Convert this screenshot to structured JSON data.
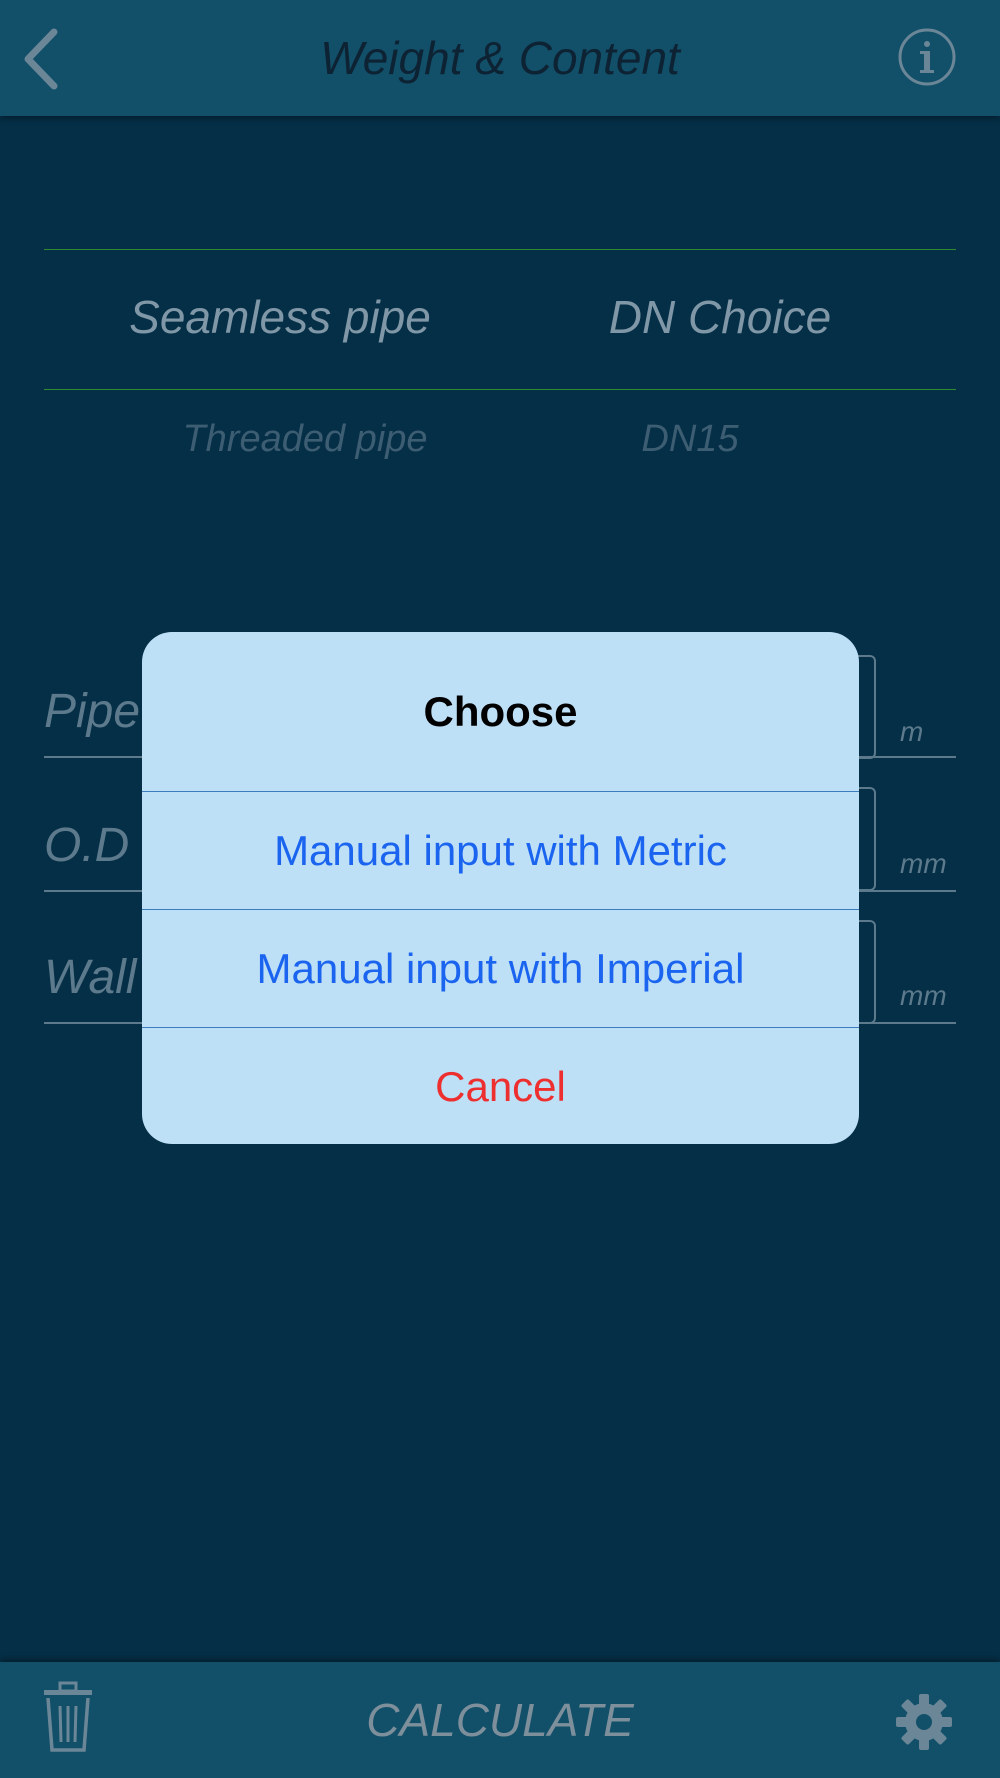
{
  "header": {
    "title": "Weight & Content",
    "back_icon": "chevron-left-icon",
    "info_icon": "info-icon"
  },
  "picker": {
    "selected": {
      "pipe_type": "Seamless pipe",
      "dn": "DN Choice"
    },
    "next": {
      "pipe_type": "Threaded pipe",
      "dn": "DN15"
    }
  },
  "fields": [
    {
      "label": "Pipe",
      "unit": "m"
    },
    {
      "label": "O.D",
      "unit": "mm"
    },
    {
      "label": "Wall",
      "unit": "mm"
    }
  ],
  "dialog": {
    "title": "Choose",
    "options": [
      "Manual input with Metric",
      "Manual input with Imperial"
    ],
    "cancel": "Cancel"
  },
  "bottom_bar": {
    "calculate": "CALCULATE",
    "trash_icon": "trash-icon",
    "settings_icon": "gear-icon"
  },
  "colors": {
    "background": "#052f47",
    "bar": "#124f69",
    "picker_line": "#2f8a2f",
    "dialog_bg": "#bde0f6",
    "option_blue": "#1a64f0",
    "cancel_red": "#ee2f2f"
  }
}
